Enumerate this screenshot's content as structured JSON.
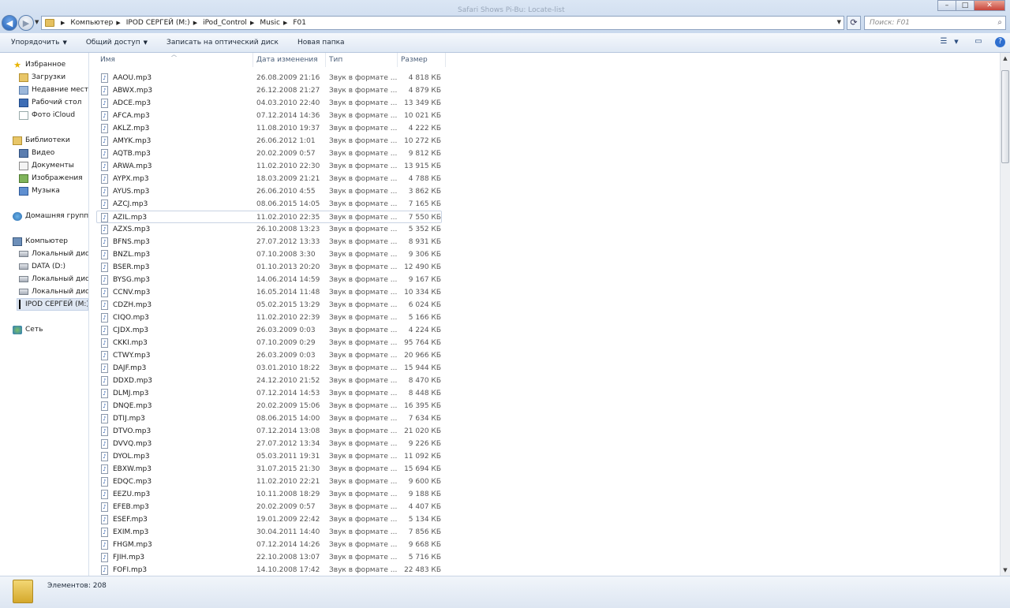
{
  "window": {
    "ghost_title": "Safari Shows Pi-Bu: Locate-list",
    "min_icon": "minimize-icon",
    "max_icon": "maximize-icon",
    "close_icon": "close-icon"
  },
  "address": {
    "crumbs": [
      "Компьютер",
      "IPOD СЕРГЕЙ (M:)",
      "iPod_Control",
      "Music",
      "F01"
    ],
    "search_placeholder": "Поиск: F01"
  },
  "toolbar": {
    "organize": "Упорядочить",
    "share": "Общий доступ",
    "burn": "Записать на оптический диск",
    "new_folder": "Новая папка"
  },
  "nav": {
    "favorites": "Избранное",
    "downloads": "Загрузки",
    "recent": "Недавние места",
    "desktop": "Рабочий стол",
    "icloud": "Фото iCloud",
    "libraries": "Библиотеки",
    "video": "Видео",
    "documents": "Документы",
    "pictures": "Изображения",
    "music": "Музыка",
    "homegroup": "Домашняя группа",
    "computer": "Компьютер",
    "disk_c": "Локальный диск",
    "disk_d": "DATA (D:)",
    "disk_e": "Локальный диск",
    "disk_f": "Локальный диск",
    "ipod": "IPOD СЕРГЕЙ (M:)",
    "network": "Сеть"
  },
  "columns": {
    "name": "Имя",
    "date": "Дата изменения",
    "type": "Тип",
    "size": "Размер"
  },
  "files": [
    {
      "name": "AAOU.mp3",
      "date": "26.08.2009 21:16",
      "type": "Звук в формате ...",
      "size": "4 818 КБ"
    },
    {
      "name": "ABWX.mp3",
      "date": "26.12.2008 21:27",
      "type": "Звук в формате ...",
      "size": "4 879 КБ"
    },
    {
      "name": "ADCE.mp3",
      "date": "04.03.2010 22:40",
      "type": "Звук в формате ...",
      "size": "13 349 КБ"
    },
    {
      "name": "AFCA.mp3",
      "date": "07.12.2014 14:36",
      "type": "Звук в формате ...",
      "size": "10 021 КБ"
    },
    {
      "name": "AKLZ.mp3",
      "date": "11.08.2010 19:37",
      "type": "Звук в формате ...",
      "size": "4 222 КБ"
    },
    {
      "name": "AMYK.mp3",
      "date": "26.06.2012 1:01",
      "type": "Звук в формате ...",
      "size": "10 272 КБ"
    },
    {
      "name": "AQTB.mp3",
      "date": "20.02.2009 0:57",
      "type": "Звук в формате ...",
      "size": "9 812 КБ"
    },
    {
      "name": "ARWA.mp3",
      "date": "11.02.2010 22:30",
      "type": "Звук в формате ...",
      "size": "13 915 КБ"
    },
    {
      "name": "AYPX.mp3",
      "date": "18.03.2009 21:21",
      "type": "Звук в формате ...",
      "size": "4 788 КБ"
    },
    {
      "name": "AYUS.mp3",
      "date": "26.06.2010 4:55",
      "type": "Звук в формате ...",
      "size": "3 862 КБ"
    },
    {
      "name": "AZCJ.mp3",
      "date": "08.06.2015 14:05",
      "type": "Звук в формате ...",
      "size": "7 165 КБ"
    },
    {
      "name": "AZIL.mp3",
      "date": "11.02.2010 22:35",
      "type": "Звук в формате ...",
      "size": "7 550 КБ",
      "selected": true
    },
    {
      "name": "AZXS.mp3",
      "date": "26.10.2008 13:23",
      "type": "Звук в формате ...",
      "size": "5 352 КБ"
    },
    {
      "name": "BFNS.mp3",
      "date": "27.07.2012 13:33",
      "type": "Звук в формате ...",
      "size": "8 931 КБ"
    },
    {
      "name": "BNZL.mp3",
      "date": "07.10.2008 3:30",
      "type": "Звук в формате ...",
      "size": "9 306 КБ"
    },
    {
      "name": "BSER.mp3",
      "date": "01.10.2013 20:20",
      "type": "Звук в формате ...",
      "size": "12 490 КБ"
    },
    {
      "name": "BYSG.mp3",
      "date": "14.06.2014 14:59",
      "type": "Звук в формате ...",
      "size": "9 167 КБ"
    },
    {
      "name": "CCNV.mp3",
      "date": "16.05.2014 11:48",
      "type": "Звук в формате ...",
      "size": "10 334 КБ"
    },
    {
      "name": "CDZH.mp3",
      "date": "05.02.2015 13:29",
      "type": "Звук в формате ...",
      "size": "6 024 КБ"
    },
    {
      "name": "CIQO.mp3",
      "date": "11.02.2010 22:39",
      "type": "Звук в формате ...",
      "size": "5 166 КБ"
    },
    {
      "name": "CJDX.mp3",
      "date": "26.03.2009 0:03",
      "type": "Звук в формате ...",
      "size": "4 224 КБ"
    },
    {
      "name": "CKKI.mp3",
      "date": "07.10.2009 0:29",
      "type": "Звук в формате ...",
      "size": "95 764 КБ"
    },
    {
      "name": "CTWY.mp3",
      "date": "26.03.2009 0:03",
      "type": "Звук в формате ...",
      "size": "20 966 КБ"
    },
    {
      "name": "DAJF.mp3",
      "date": "03.01.2010 18:22",
      "type": "Звук в формате ...",
      "size": "15 944 КБ"
    },
    {
      "name": "DDXD.mp3",
      "date": "24.12.2010 21:52",
      "type": "Звук в формате ...",
      "size": "8 470 КБ"
    },
    {
      "name": "DLMJ.mp3",
      "date": "07.12.2014 14:53",
      "type": "Звук в формате ...",
      "size": "8 448 КБ"
    },
    {
      "name": "DNQE.mp3",
      "date": "20.02.2009 15:06",
      "type": "Звук в формате ...",
      "size": "16 395 КБ"
    },
    {
      "name": "DTIJ.mp3",
      "date": "08.06.2015 14:00",
      "type": "Звук в формате ...",
      "size": "7 634 КБ"
    },
    {
      "name": "DTVO.mp3",
      "date": "07.12.2014 13:08",
      "type": "Звук в формате ...",
      "size": "21 020 КБ"
    },
    {
      "name": "DVVQ.mp3",
      "date": "27.07.2012 13:34",
      "type": "Звук в формате ...",
      "size": "9 226 КБ"
    },
    {
      "name": "DYOL.mp3",
      "date": "05.03.2011 19:31",
      "type": "Звук в формате ...",
      "size": "11 092 КБ"
    },
    {
      "name": "EBXW.mp3",
      "date": "31.07.2015 21:30",
      "type": "Звук в формате ...",
      "size": "15 694 КБ"
    },
    {
      "name": "EDQC.mp3",
      "date": "11.02.2010 22:21",
      "type": "Звук в формате ...",
      "size": "9 600 КБ"
    },
    {
      "name": "EEZU.mp3",
      "date": "10.11.2008 18:29",
      "type": "Звук в формате ...",
      "size": "9 188 КБ"
    },
    {
      "name": "EFEB.mp3",
      "date": "20.02.2009 0:57",
      "type": "Звук в формате ...",
      "size": "4 407 КБ"
    },
    {
      "name": "ESEF.mp3",
      "date": "19.01.2009 22:42",
      "type": "Звук в формате ...",
      "size": "5 134 КБ"
    },
    {
      "name": "EXIM.mp3",
      "date": "30.04.2011 14:40",
      "type": "Звук в формате ...",
      "size": "7 856 КБ"
    },
    {
      "name": "FHGM.mp3",
      "date": "07.12.2014 14:26",
      "type": "Звук в формате ...",
      "size": "9 668 КБ"
    },
    {
      "name": "FJIH.mp3",
      "date": "22.10.2008 13:07",
      "type": "Звук в формате ...",
      "size": "5 716 КБ"
    },
    {
      "name": "FOFI.mp3",
      "date": "14.10.2008 17:42",
      "type": "Звук в формате ...",
      "size": "22 483 КБ"
    }
  ],
  "status": {
    "count": "Элементов: 208"
  }
}
